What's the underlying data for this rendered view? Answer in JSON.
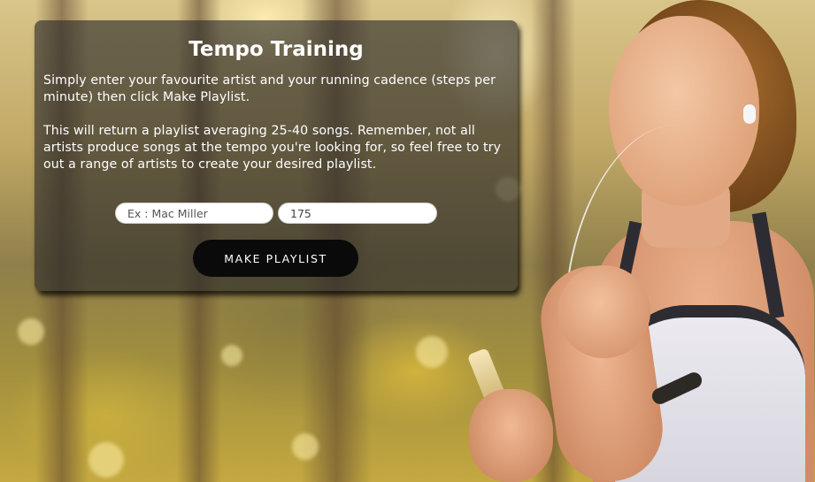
{
  "panel": {
    "title": "Tempo Training",
    "description_1": "Simply enter your favourite artist and your running cadence (steps per minute) then click Make Playlist.",
    "description_2": "This will return a playlist averaging 25-40 songs. Remember, not all artists produce songs at the tempo you're looking for, so feel free to try out a range of artists to create your desired playlist."
  },
  "form": {
    "artist_placeholder": "Ex : Mac Miller",
    "artist_value": "",
    "cadence_placeholder": "",
    "cadence_value": "175",
    "submit_label": "MAKE PLAYLIST"
  },
  "colors": {
    "panel_overlay": "#282828",
    "button_bg": "#0a0a0a",
    "text": "#ffffff"
  },
  "background": {
    "scene": "runner-photo"
  }
}
